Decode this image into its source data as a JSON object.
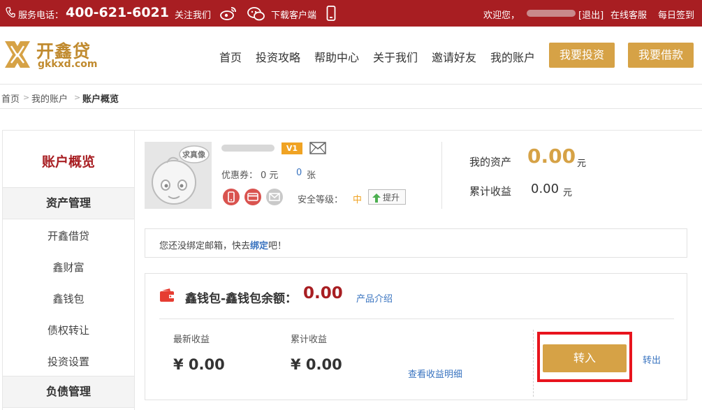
{
  "topbar": {
    "service_label": "服务电话：",
    "service_phone": "400-621-6021",
    "follow_label": "关注我们",
    "download_label": "下载客户端",
    "welcome_label": "欢迎您，",
    "logout_label": "[退出]",
    "online_service": "在线客服",
    "daily_checkin": "每日签到"
  },
  "header": {
    "logo_text": "开鑫贷",
    "logo_domain": "gkkxd.com",
    "nav": [
      "首页",
      "投资攻略",
      "帮助中心",
      "关于我们",
      "邀请好友",
      "我的账户"
    ],
    "invest_button": "我要投资",
    "borrow_button": "我要借款"
  },
  "breadcrumb": {
    "items": [
      "首页",
      "我的账户",
      "账户概览"
    ],
    "sep": ">"
  },
  "sidebar": {
    "title": "账户概览",
    "sections": [
      {
        "title": "资产管理",
        "items": [
          "开鑫借贷",
          "鑫财富",
          "鑫钱包",
          "债权转让",
          "投资设置"
        ]
      },
      {
        "title": "负债管理",
        "items": []
      }
    ]
  },
  "profile": {
    "avatar_badge": "求真像",
    "vip_level": "V1",
    "coupon_label": "优惠券：",
    "coupon_value": "0 元",
    "coupon_count": "0",
    "coupon_unit": "张",
    "security_label": "安全等级：",
    "security_level": "中",
    "upgrade_label": "提升",
    "colors": {
      "accent_red": "#d9534f",
      "gold": "#d6a246",
      "brand_red": "#a81e22"
    }
  },
  "assets": {
    "my_assets_label": "我的资产",
    "my_assets_value": "0.00",
    "my_assets_unit": "元",
    "total_income_label": "累计收益",
    "total_income_value": "0.00",
    "total_income_unit": "元"
  },
  "notice": {
    "text_before": "您还没绑定邮箱，快去",
    "link": "绑定",
    "text_after": "吧！"
  },
  "wallet": {
    "title": "鑫钱包-鑫钱包余额：",
    "balance": "0.00",
    "intro_link": "产品介绍",
    "latest_income_label": "最新收益",
    "latest_income_value": "¥ 0.00",
    "total_income_label": "累计收益",
    "total_income_value": "¥ 0.00",
    "detail_link": "查看收益明细",
    "transfer_in": "转入",
    "transfer_out": "转出"
  }
}
